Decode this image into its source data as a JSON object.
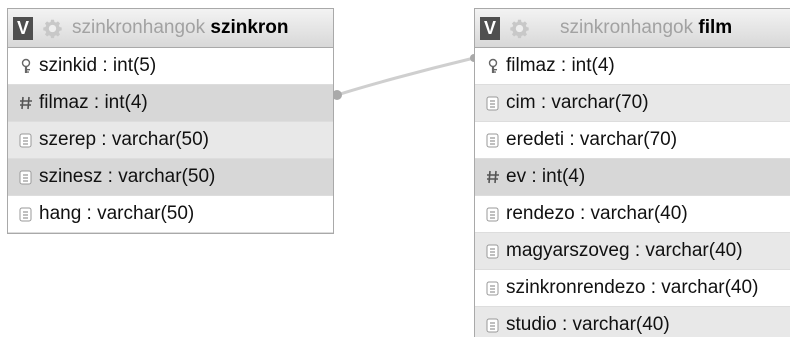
{
  "icons": {
    "view_badge": "v-badge-icon",
    "settings": "gear-icon",
    "key": "key-icon",
    "numeric": "hash-icon",
    "text": "text-column-icon"
  },
  "colors": {
    "header_start": "#f3f3f3",
    "header_end": "#d8d8d8",
    "border": "#a9a9a9",
    "row_shade": "#e8e8e8",
    "row_shade_strong": "#d7d7d7",
    "relation_line": "#cfcfcf"
  },
  "tables": [
    {
      "badge": "V",
      "database": "szinkronhangok",
      "name": "szinkron",
      "columns": [
        {
          "icon": "key",
          "label": "szinkid : int(5)"
        },
        {
          "icon": "numeric",
          "label": "filmaz : int(4)"
        },
        {
          "icon": "text",
          "label": "szerep : varchar(50)"
        },
        {
          "icon": "text",
          "label": "szinesz : varchar(50)"
        },
        {
          "icon": "text",
          "label": "hang : varchar(50)"
        }
      ]
    },
    {
      "badge": "V",
      "database": "szinkronhangok",
      "name": "film",
      "columns": [
        {
          "icon": "key",
          "label": "filmaz : int(4)"
        },
        {
          "icon": "text",
          "label": "cim : varchar(70)"
        },
        {
          "icon": "text",
          "label": "eredeti : varchar(70)"
        },
        {
          "icon": "numeric",
          "label": "ev : int(4)"
        },
        {
          "icon": "text",
          "label": "rendezo : varchar(40)"
        },
        {
          "icon": "text",
          "label": "magyarszoveg : varchar(40)"
        },
        {
          "icon": "text",
          "label": "szinkronrendezo : varchar(40)"
        },
        {
          "icon": "text",
          "label": "studio : varchar(40)"
        }
      ]
    }
  ]
}
